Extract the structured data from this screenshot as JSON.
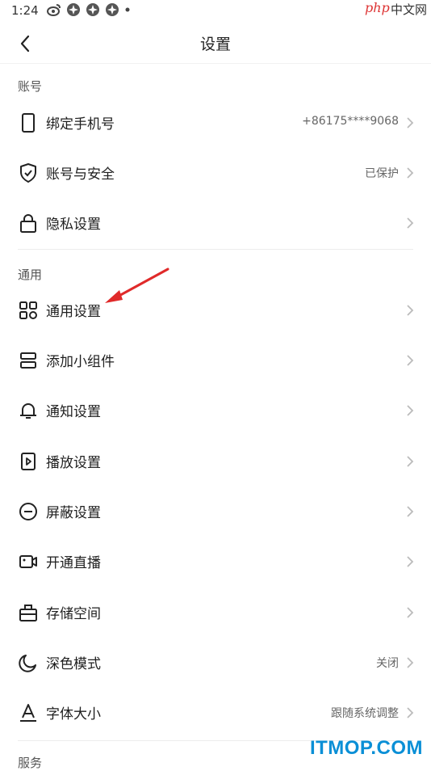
{
  "status_bar": {
    "time": "1:24",
    "icons": [
      "weibo-icon",
      "app-icon",
      "app-icon",
      "app-icon",
      "dot-icon"
    ]
  },
  "watermark": {
    "php": "php",
    "cn": "中文网",
    "bottom": "ITMOP.COM"
  },
  "nav": {
    "title": "设置",
    "back_icon": "chevron-left-icon"
  },
  "sections": {
    "account": {
      "label": "账号",
      "items": [
        {
          "label": "绑定手机号",
          "value": "+86175****9068",
          "icon": "phone-icon"
        },
        {
          "label": "账号与安全",
          "value": "已保护",
          "icon": "shield-icon"
        },
        {
          "label": "隐私设置",
          "value": "",
          "icon": "lock-icon"
        }
      ]
    },
    "general": {
      "label": "通用",
      "items": [
        {
          "label": "通用设置",
          "value": "",
          "icon": "grid-icon"
        },
        {
          "label": "添加小组件",
          "value": "",
          "icon": "widget-icon"
        },
        {
          "label": "通知设置",
          "value": "",
          "icon": "bell-icon"
        },
        {
          "label": "播放设置",
          "value": "",
          "icon": "play-icon"
        },
        {
          "label": "屏蔽设置",
          "value": "",
          "icon": "block-icon"
        },
        {
          "label": "开通直播",
          "value": "",
          "icon": "live-icon"
        },
        {
          "label": "存储空间",
          "value": "",
          "icon": "storage-icon"
        },
        {
          "label": "深色模式",
          "value": "关闭",
          "icon": "moon-icon"
        },
        {
          "label": "字体大小",
          "value": "跟随系统调整",
          "icon": "font-icon"
        }
      ]
    },
    "service": {
      "label": "服务"
    }
  },
  "colors": {
    "annotation_arrow": "#e02a2a",
    "watermark_blue": "#0a8fd6"
  }
}
